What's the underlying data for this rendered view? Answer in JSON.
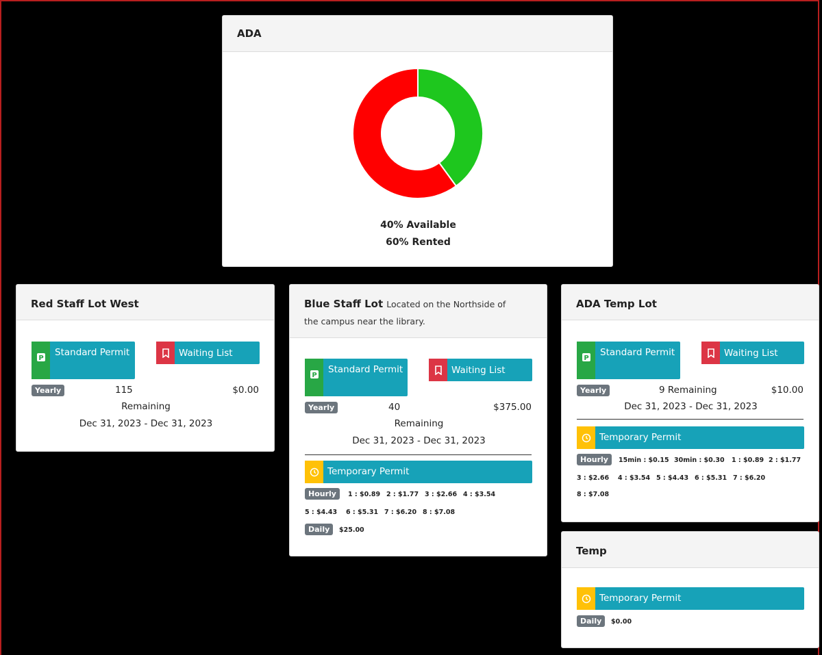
{
  "ada_card": {
    "title": "ADA",
    "available_label": "40% Available",
    "rented_label": "60% Rented",
    "available_pct": 40,
    "rented_pct": 60,
    "available_color": "#1ec71e",
    "rented_color": "#ff0000"
  },
  "red_lot": {
    "title": "Red Staff Lot West",
    "standard_label": "Standard Permit",
    "waiting_label": "Waiting List",
    "period_badge": "Yearly",
    "remaining_count": "115",
    "remaining_word": "Remaining",
    "price": "$0.00",
    "dates": "Dec 31, 2023 - Dec 31, 2023"
  },
  "blue_lot": {
    "title": "Blue Staff Lot",
    "subtitle_a": "Located on the Northside of",
    "subtitle_b": "the campus near the library.",
    "standard_label": "Standard Permit",
    "waiting_label": "Waiting List",
    "period_badge": "Yearly",
    "remaining_count": "40",
    "remaining_word": "Remaining",
    "price": "$375.00",
    "dates": "Dec 31, 2023 - Dec 31, 2023",
    "temp_label": "Temporary Permit",
    "hourly_badge": "Hourly",
    "hourly_rates": [
      "1 : $0.89",
      "2 : $1.77",
      "3 : $2.66",
      "4 : $3.54",
      "5 : $4.43",
      "6 : $5.31",
      "7 : $6.20",
      "8 : $7.08"
    ],
    "daily_badge": "Daily",
    "daily_rate": "$25.00"
  },
  "ada_temp_lot": {
    "title": "ADA Temp Lot",
    "standard_label": "Standard Permit",
    "waiting_label": "Waiting List",
    "period_badge": "Yearly",
    "remaining": "9 Remaining",
    "price": "$10.00",
    "dates": "Dec 31, 2023 - Dec 31, 2023",
    "temp_label": "Temporary Permit",
    "hourly_badge": "Hourly",
    "hourly_rates": [
      "15min : $0.15",
      "30min : $0.30",
      "1 : $0.89",
      "2 : $1.77",
      "3 : $2.66",
      "4 : $3.54",
      "5 : $4.43",
      "6 : $5.31",
      "7 : $6.20",
      "8 : $7.08"
    ]
  },
  "temp_card": {
    "title": "Temp",
    "temp_label": "Temporary Permit",
    "daily_badge": "Daily",
    "daily_rate": "$0.00"
  },
  "icons": {
    "standard": "parking-icon",
    "waiting": "bookmark-icon",
    "temporary": "clock-icon"
  }
}
